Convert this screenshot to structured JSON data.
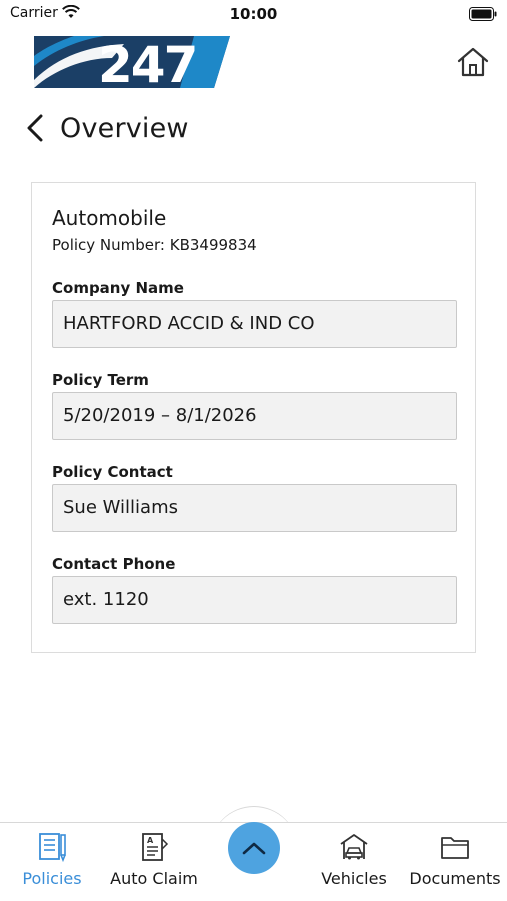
{
  "status_bar": {
    "carrier": "Carrier",
    "time": "10:00"
  },
  "logo": {
    "text": "247"
  },
  "header": {
    "title": "Overview"
  },
  "policy": {
    "type": "Automobile",
    "number": "Policy Number: KB3499834",
    "fields": [
      {
        "label": "Company Name",
        "value": "HARTFORD ACCID & IND CO"
      },
      {
        "label": "Policy Term",
        "value": "5/20/2019 – 8/1/2026"
      },
      {
        "label": "Policy Contact",
        "value": "Sue Williams"
      },
      {
        "label": "Contact Phone",
        "value": "ext. 1120"
      }
    ]
  },
  "tab_bar": {
    "tabs": [
      {
        "label": "Policies",
        "icon": "document-pen-icon",
        "active": true
      },
      {
        "label": "Auto Claim",
        "icon": "claim-form-icon",
        "active": false
      },
      {
        "label": "Vehicles",
        "icon": "garage-car-icon",
        "active": false
      },
      {
        "label": "Documents",
        "icon": "folder-icon",
        "active": false
      }
    ],
    "center_button_icon": "chevron-up-icon"
  },
  "colors": {
    "accent": "#4ea3e0",
    "active_tab": "#3a8ed8",
    "logo_navy": "#1b3f66",
    "logo_blue": "#1e88c8"
  }
}
